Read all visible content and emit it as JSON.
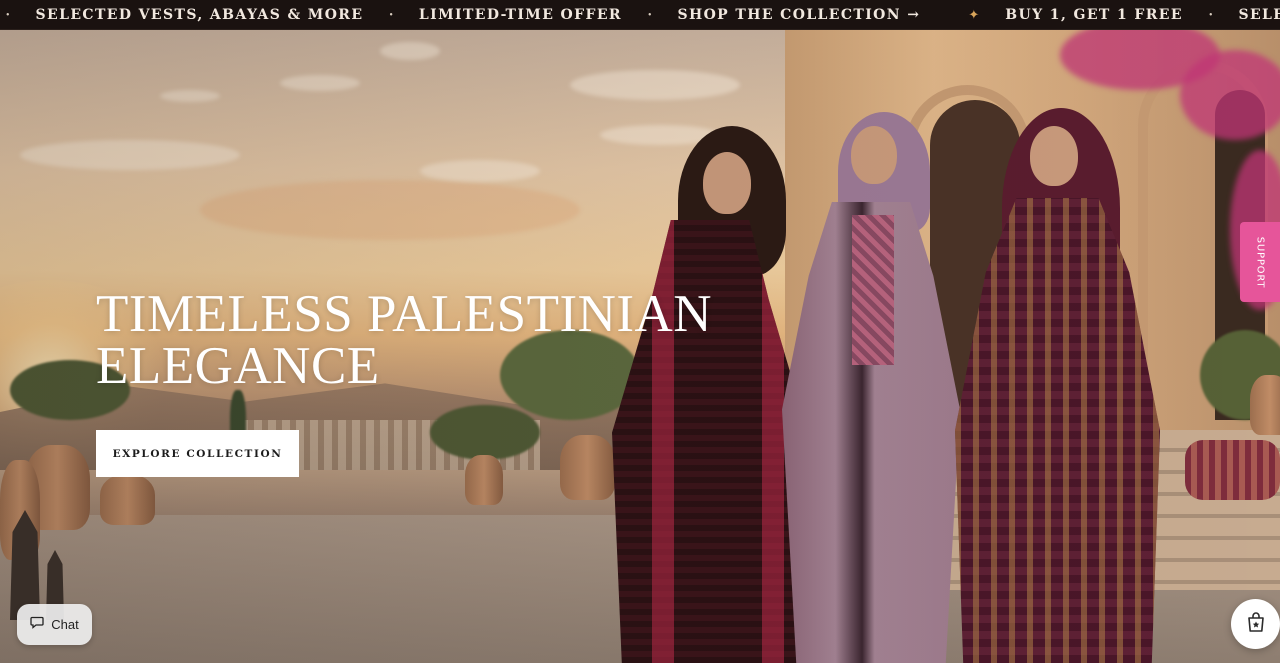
{
  "announcement_bar": {
    "items": [
      {
        "text": "SELECTED VESTS, ABAYAS & MORE",
        "separator": "•"
      },
      {
        "text": "LIMITED-TIME OFFER",
        "separator": "•"
      },
      {
        "text": "SHOP THE COLLECTION →",
        "separator": "✦"
      },
      {
        "text": "BUY 1, GET 1 FREE",
        "separator": "•"
      },
      {
        "text": "SELECTED VESTS, ABAYAS & MORE",
        "separator": ""
      }
    ],
    "lead_separator": "•"
  },
  "hero": {
    "title_line1": "TIMELESS PALESTINIAN",
    "title_line2": "ELEGANCE",
    "cta_label": "EXPLORE COLLECTION"
  },
  "support_tab": {
    "label": "SUPPORT"
  },
  "chat_widget": {
    "label": "Chat",
    "icon": "chat-bubble-icon"
  },
  "shop_widget": {
    "icon": "shopping-bag-icon"
  },
  "colors": {
    "announcement_bg": "#1a1210",
    "support_accent": "#e6559a",
    "cta_bg": "#ffffff"
  }
}
